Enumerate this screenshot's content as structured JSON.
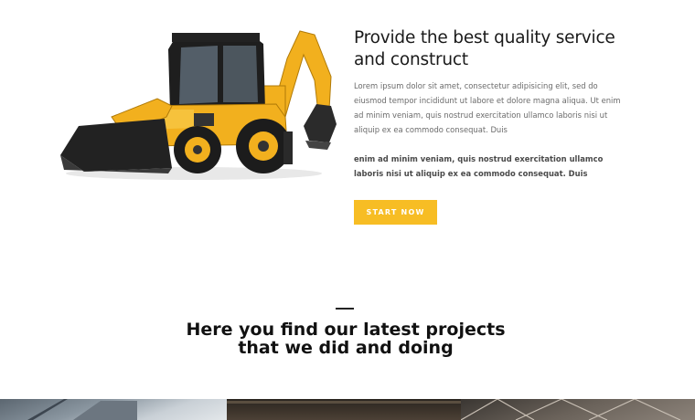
{
  "intro": {
    "title_line1": "Provide the best quality service",
    "title_line2": "and construct",
    "paragraph": "Lorem ipsum dolor sit amet, consectetur adipisicing elit, sed do eiusmod tempor incididunt ut labore et dolore magna aliqua. Ut enim ad minim veniam, quis nostrud exercitation ullamco laboris nisi ut aliquip ex ea commodo consequat. Duis",
    "bold_paragraph": "enim ad minim veniam, quis nostrud exercitation ullamco laboris nisi ut aliquip ex ea commodo consequat. Duis",
    "cta_label": "START NOW"
  },
  "projects": {
    "heading_line1": "Here you find our latest projects",
    "heading_line2": "that we did and doing"
  },
  "colors": {
    "accent": "#f7bd24",
    "heading": "#111111",
    "body_text": "#6b6b6b"
  }
}
